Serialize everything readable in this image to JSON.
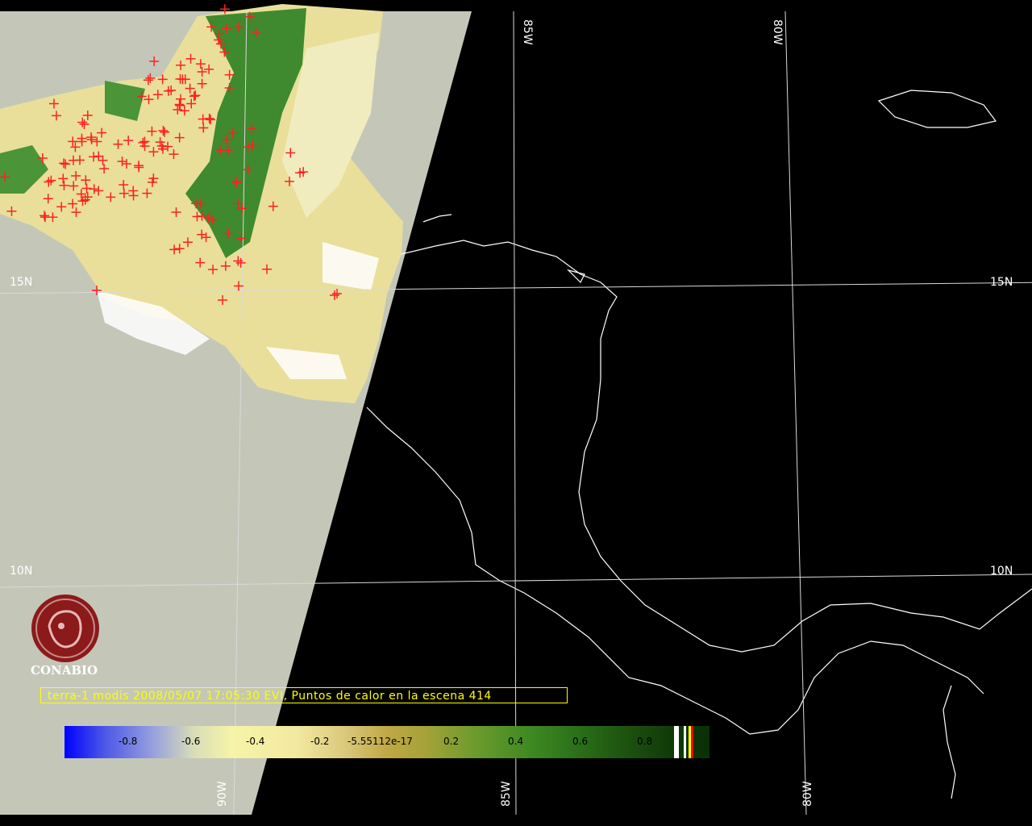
{
  "labels": {
    "lat_15_left": "15N",
    "lat_15_right": "15N",
    "lat_10_left": "10N",
    "lat_10_right": "10N",
    "lon_85_top": "85W",
    "lon_80_top": "80W",
    "lon_90_bottom": "90W",
    "lon_85_bottom": "85W",
    "lon_80_bottom": "80W"
  },
  "caption": "terra-1 modis 2008/05/07 17:05:30 EVI, Puntos de calor en la escena 414",
  "logo_text": "CONABIO",
  "colorbar": {
    "ticks": [
      "-0.8",
      "-0.6",
      "-0.4",
      "-0.2",
      "-5.55112e-17",
      "0.2",
      "0.4",
      "0.6",
      "0.8"
    ]
  },
  "colors": {
    "caption": "#ffff00",
    "fire_marker": "#ff2020",
    "logo": "#8b1a1a",
    "no_data_swath": "#c4c7b8",
    "coastline": "#ffffff"
  },
  "hotspot_count_label": "414"
}
